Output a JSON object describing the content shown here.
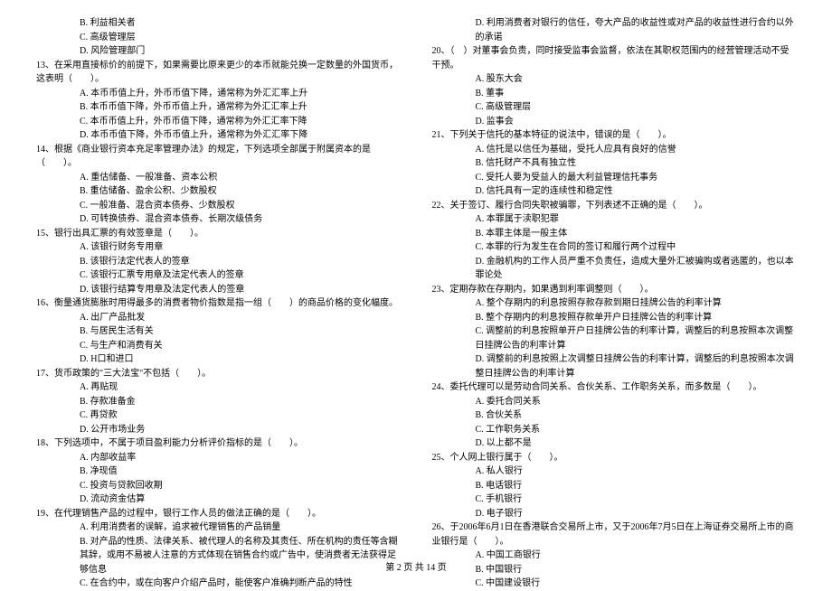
{
  "left": {
    "q12_opts": [
      "B. 利益相关者",
      "C. 高级管理层",
      "D. 风险管理部门"
    ],
    "q13": "13、在采用直接标价的前提下，如果需要比原来更少的本币就能兑换一定数量的外国货币，这表明（　　）。",
    "q13_opts": [
      "A. 本币币值上升，外币币值下降，通常称为外汇汇率上升",
      "B. 本币币值下降，外币币值上升，通常称为外汇汇率上升",
      "C. 本币币值上升，外币币值下降，通常称为外汇汇率下降",
      "D. 本币币值下降，外币币值上升，通常称为外汇汇率下降"
    ],
    "q14": "14、根据《商业银行资本充足率管理办法》的规定，下列选项全部属于附属资本的是（　　）。",
    "q14_opts": [
      "A. 重估储备、一般准备、资本公积",
      "B. 重估储备、盈余公积、少数股权",
      "C. 一般准备、混合资本债券、少数股权",
      "D. 可转换债券、混合资本债券、长期次级债务"
    ],
    "q15": "15、银行出具汇票的有效签章是（　　）。",
    "q15_opts": [
      "A. 该银行财务专用章",
      "B. 该银行法定代表人的签章",
      "C. 该银行汇票专用章及法定代表人的签章",
      "D. 该银行结算专用章及法定代表人的签章"
    ],
    "q16": "16、衡量通货膨胀时用得最多的消费者物价指数是指一组（　　）的商品价格的变化幅度。",
    "q16_opts": [
      "A. 出厂产品批发",
      "B. 与居民生活有关",
      "C. 与生产和消费有关",
      "D. H口和进口"
    ],
    "q17": "17、货币政策的\"三大法宝\"不包括（　　）。",
    "q17_opts": [
      "A. 再贴现",
      "B. 存款准备金",
      "C. 再贷款",
      "D. 公开市场业务"
    ],
    "q18": "18、下列选项中，不属于项目盈利能力分析评价指标的是（　　）。",
    "q18_opts": [
      "A. 内部收益率",
      "B. 净现值",
      "C. 投资与贷款回收期",
      "D. 流动资金估算"
    ],
    "q19": "19、在代理销售产品的过程中，银行工作人员的做法正确的是（　　）。",
    "q19_opts": [
      "A. 利用消费者的误解，追求被代理销售的产品销量",
      "B. 对产品的性质、法律关系、被代理人的名称及其责任、所在机构的责任等含糊其辞，或用不易被人注意的方式体现在销售合约或广告中，使消费者无法获得足够信息",
      "C. 在合约中，或在向客户介绍产品时，能使客户准确判断产品的特性"
    ]
  },
  "right": {
    "q19_d": "D. 利用消费者对银行的信任，夸大产品的收益性或对产品的收益性进行合约以外的承诺",
    "q20": "20、（　）对董事会负责，同时接受监事会监督，依法在其职权范围内的经营管理活动不受干预。",
    "q20_opts": [
      "A. 股东大会",
      "B. 董事",
      "C. 高级管理层",
      "D. 监事会"
    ],
    "q21": "21、下列关于信托的基本特征的说法中，错误的是（　　）。",
    "q21_opts": [
      "A. 信托是以信任为基础，受托人应具有良好的信誉",
      "B. 信托财产不具有独立性",
      "C. 受托人要为受益人的最大利益管理信托事务",
      "D. 信托具有一定的连续性和稳定性"
    ],
    "q22": "22、关于签订、履行合同失职被骗罪，下列表述不正确的是（　　）。",
    "q22_opts": [
      "A. 本罪属于渎职犯罪",
      "B. 本罪主体是一般主体",
      "C. 本罪的行为发生在合同的签订和履行两个过程中",
      "D. 金融机构的工作人员严重不负责任，造成大量外汇被骗购或者逃匿的，也以本罪论处"
    ],
    "q23": "23、定期存款在存期内，如果遇到利率调整则（　　）。",
    "q23_opts": [
      "A. 整个存期内的利息按照存款存款到期日挂牌公告的利率计算",
      "B. 整个存期内的利息按照存款单开户日挂牌公告的利率计算",
      "C. 调整前的利息按照单开户日挂牌公告的利率计算，调整后的利息按照本次调整日挂牌公告的利率计算",
      "D. 调整前的利息按照上次调整日挂牌公告的利率计算，调整后的利息按照本次调整日挂牌公告的利率计算"
    ],
    "q24": "24、委托代理可以是劳动合同关系、合伙关系、工作职务关系，而多数是（　　）。",
    "q24_opts": [
      "A. 委托合同关系",
      "B. 合伙关系",
      "C. 工作职务关系",
      "D. 以上都不是"
    ],
    "q25": "25、个人网上银行属于（　　）。",
    "q25_opts": [
      "A. 私人银行",
      "B. 电话银行",
      "C. 手机银行",
      "D. 电子银行"
    ],
    "q26": "26、于2006年6月1日在香港联合交易所上市，又于2006年7月5日在上海证券交易所上市的商业银行是（　　）。",
    "q26_opts": [
      "A. 中国工商银行",
      "B. 中国银行",
      "C. 中国建设银行"
    ]
  },
  "footer": "第 2 页 共 14 页"
}
